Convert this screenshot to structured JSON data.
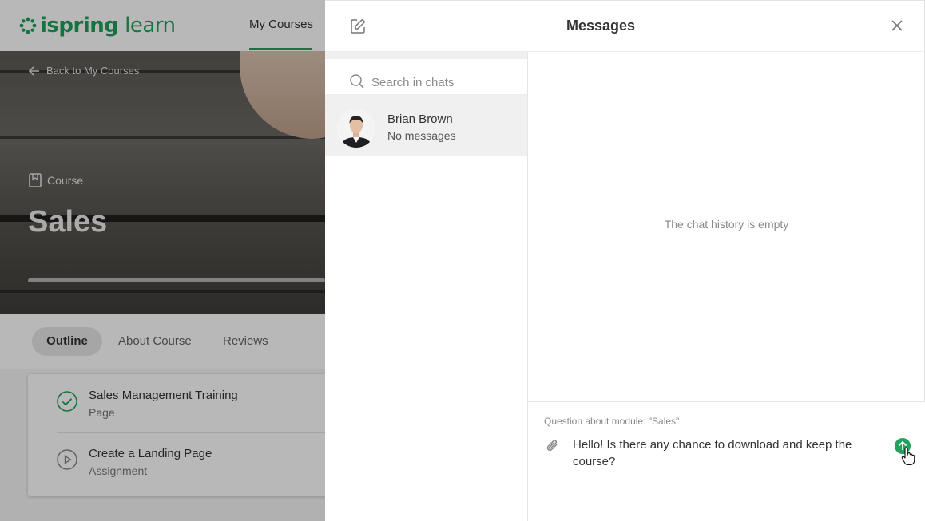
{
  "app": {
    "logo_text_bold": "ispring",
    "logo_text_light": " learn",
    "brand_color": "#22a05c"
  },
  "nav": {
    "my_courses": "My Courses"
  },
  "hero": {
    "back_label": "Back to My Courses",
    "course_tag": "Course",
    "course_title": "Sales"
  },
  "tabs": {
    "outline": "Outline",
    "about": "About Course",
    "reviews": "Reviews"
  },
  "outline": {
    "items": [
      {
        "title": "Sales Management Training",
        "type": "Page",
        "icon": "check-circle-icon"
      },
      {
        "title": "Create a Landing Page",
        "type": "Assignment",
        "icon": "play-circle-icon"
      }
    ]
  },
  "messages": {
    "title": "Messages",
    "search_placeholder": "Search in chats",
    "chats": [
      {
        "name": "Brian Brown",
        "preview": "No messages"
      }
    ],
    "empty_history": "The chat history is empty",
    "context_label": "Question about module: \"Sales\"",
    "draft_message": "Hello! Is there any chance to download and keep the course?"
  }
}
